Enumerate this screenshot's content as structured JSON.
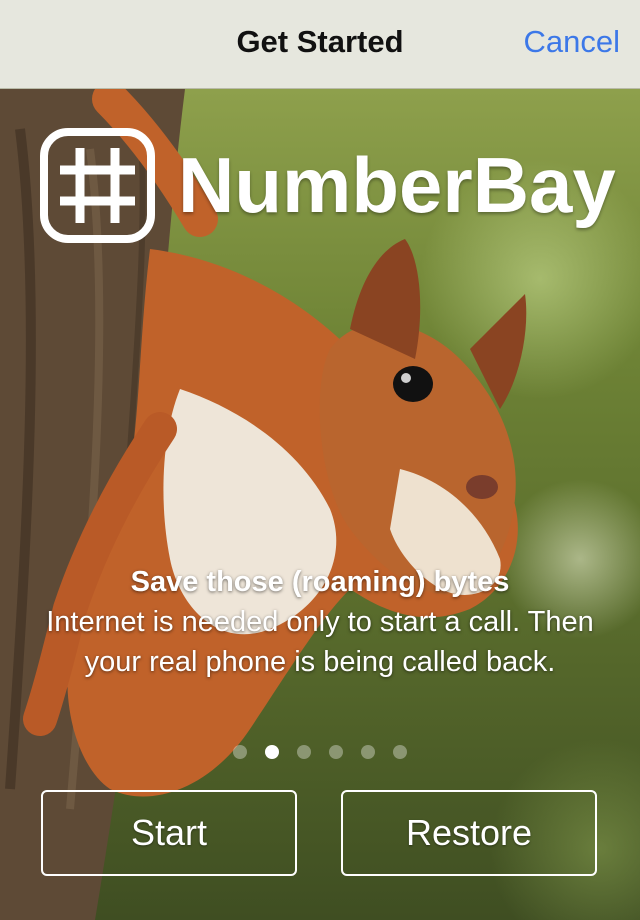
{
  "navbar": {
    "title": "Get Started",
    "cancel_label": "Cancel"
  },
  "logo": {
    "icon": "numberbay-hash-icon",
    "text": "NumberBay"
  },
  "slide": {
    "title": "Save those (roaming) bytes",
    "body": "Internet is needed only to start a call. Then your real phone is being called back."
  },
  "pagination": {
    "total": 6,
    "current": 2
  },
  "actions": {
    "start_label": "Start",
    "restore_label": "Restore"
  },
  "colors": {
    "accent": "#3c78e8",
    "navbar_bg": "#e6e7de"
  }
}
